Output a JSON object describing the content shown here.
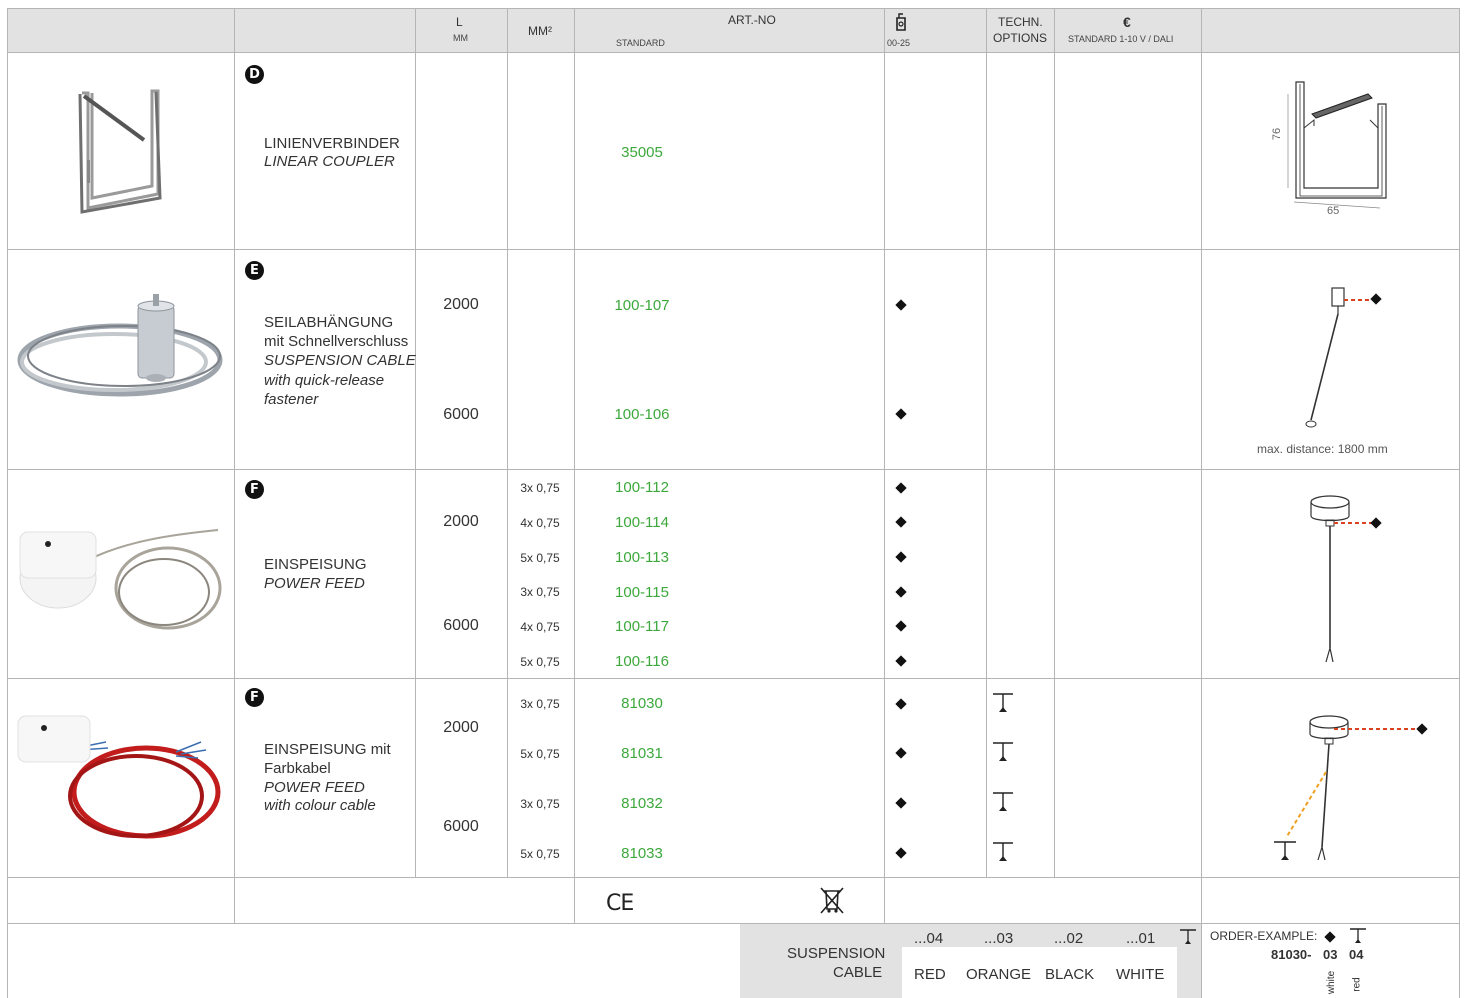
{
  "header": {
    "l_label": "L",
    "l_unit": "MM",
    "mm2_label": "MM²",
    "art_no_label": "ART.-NO",
    "standard_label": "STANDARD",
    "dim_range": "00-25",
    "techn_label": "TECHN.",
    "options_label": "OPTIONS",
    "euro_symbol": "€",
    "euro_sub": "STANDARD  1-10 V / DALI"
  },
  "rows": [
    {
      "badge": "D",
      "name_de": "LINIENVERBINDER",
      "name_en": "LINEAR COUPLER",
      "art": "35005",
      "dim_h": "76",
      "dim_w": "65"
    },
    {
      "badge": "E",
      "name_de_1": "SEILABHÄNGUNG",
      "name_de_2": "mit Schnellverschluss",
      "name_en_1": "SUSPENSION CABLE",
      "name_en_2": "with quick-release",
      "name_en_3": "fastener",
      "len_1": "2000",
      "len_2": "6000",
      "art_1": "100-107",
      "art_2": "100-106",
      "note": "max. distance: 1800 mm"
    },
    {
      "badge": "F",
      "name_de": "EINSPEISUNG",
      "name_en": "POWER FEED",
      "len_1": "2000",
      "len_2": "6000",
      "mm": [
        "3x 0,75",
        "4x 0,75",
        "5x 0,75",
        "3x 0,75",
        "4x 0,75",
        "5x 0,75"
      ],
      "arts": [
        "100-112",
        "100-114",
        "100-113",
        "100-115",
        "100-117",
        "100-116"
      ]
    },
    {
      "badge": "F",
      "name_de_1": "EINSPEISUNG mit",
      "name_de_2": "Farbkabel",
      "name_en_1": "POWER FEED",
      "name_en_2": "with colour cable",
      "len_1": "2000",
      "len_2": "6000",
      "mm": [
        "3x 0,75",
        "5x 0,75",
        "3x 0,75",
        "5x 0,75"
      ],
      "arts": [
        "81030",
        "81031",
        "81032",
        "81033"
      ]
    }
  ],
  "footer": {
    "ce": "CE",
    "suspension_1": "SUSPENSION",
    "suspension_2": "CABLE",
    "codes": [
      "...04",
      "...03",
      "...02",
      "...01"
    ],
    "colors": [
      "RED",
      "ORANGE",
      "BLACK",
      "WHITE"
    ],
    "order_label": "ORDER-EXAMPLE:",
    "order_code": "81030-",
    "order_c1": "03",
    "order_c2": "04",
    "order_white": "white",
    "order_red": "red"
  },
  "palette": {
    "green": "#3ca83c",
    "header_grey": "#e2e2e2",
    "dash_red": "#d9431e",
    "dash_orange": "#f0a020",
    "cable_red": "#c21c1c"
  }
}
